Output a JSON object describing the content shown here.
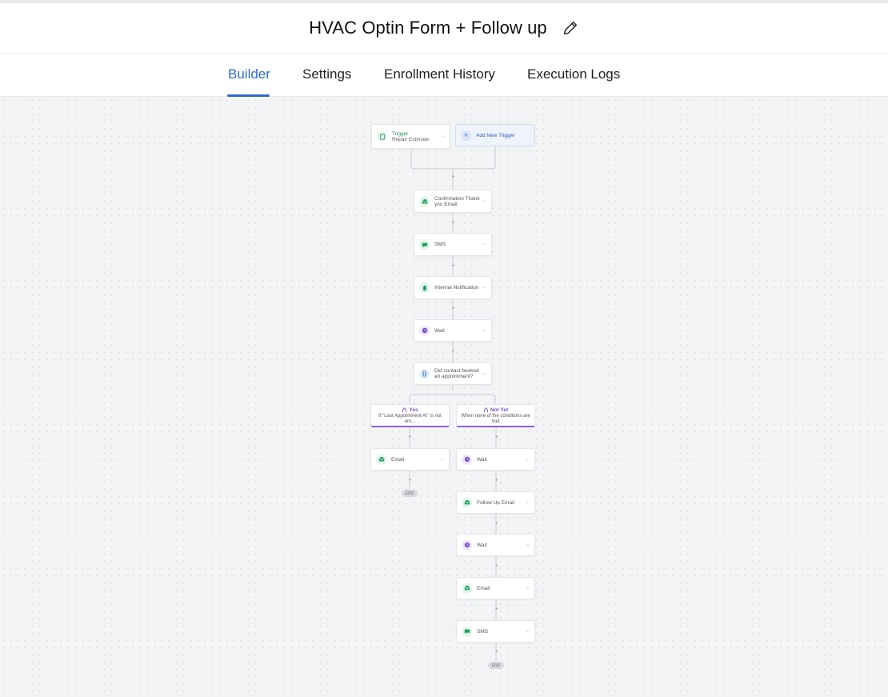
{
  "header": {
    "title": "HVAC Optin Form + Follow up"
  },
  "tabs": [
    {
      "label": "Builder",
      "active": true
    },
    {
      "label": "Settings"
    },
    {
      "label": "Enrollment History"
    },
    {
      "label": "Execution Logs"
    }
  ],
  "colors": {
    "accent": "#2f6bd0",
    "action_green": "#1f9d5a",
    "wait_purple": "#7a4fc9",
    "branch_underline": "#8a63d2"
  },
  "workflow": {
    "trigger": {
      "title": "Trigger",
      "name": "Repair Estimate",
      "icon": "form-icon"
    },
    "add_trigger": "Add New Trigger",
    "steps": [
      {
        "label": "Confirmation Thank you Email",
        "icon": "email-icon"
      },
      {
        "label": "SMS",
        "icon": "sms-icon"
      },
      {
        "label": "Internal Notification",
        "icon": "notification-icon"
      },
      {
        "label": "Wait",
        "icon": "clock-icon"
      },
      {
        "label": "Did contact booked an appointment?",
        "icon": "condition-icon"
      }
    ],
    "branches": {
      "yes": {
        "title": "Yes",
        "description": "If \"Last Appointment At\" is not em...",
        "steps": [
          {
            "label": "Email",
            "icon": "email-icon"
          }
        ],
        "end": "END"
      },
      "no": {
        "title": "Not Yet",
        "description": "When none of the conditions are met",
        "steps": [
          {
            "label": "Wait",
            "icon": "clock-icon"
          },
          {
            "label": "Follow Up Email",
            "icon": "email-icon"
          },
          {
            "label": "Wait",
            "icon": "clock-icon"
          },
          {
            "label": "Email",
            "icon": "email-icon"
          },
          {
            "label": "SMS",
            "icon": "sms-icon"
          }
        ],
        "end": "END"
      }
    }
  }
}
